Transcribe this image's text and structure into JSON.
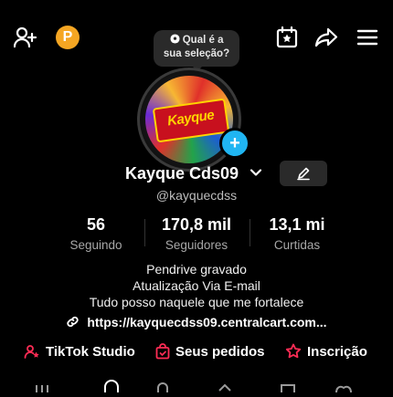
{
  "header": {
    "icons": [
      "add-user-icon",
      "coin-icon",
      "calendar-star-icon",
      "share-icon",
      "menu-icon"
    ],
    "coin_letter": "P"
  },
  "bubble": {
    "text_line1": "Qual é a",
    "text_line2": "sua seleção?"
  },
  "avatar": {
    "logo_text": "Kayque"
  },
  "profile": {
    "name": "Kayque Cds09",
    "handle": "@kayquecdss"
  },
  "stats": [
    {
      "value": "56",
      "label": "Seguindo"
    },
    {
      "value": "170,8 mil",
      "label": "Seguidores"
    },
    {
      "value": "13,1 mi",
      "label": "Curtidas"
    }
  ],
  "bio": {
    "line1": "Pendrive gravado",
    "line2": "Atualização Via E-mail",
    "line3": "Tudo posso naquele que me fortalece",
    "link": "https://kayquecdss09.centralcart.com..."
  },
  "actions": {
    "studio": "TikTok Studio",
    "orders": "Seus pedidos",
    "subscription": "Inscrição"
  },
  "colors": {
    "accent_red": "#fe2c55",
    "badge_blue": "#20b5f2",
    "coin_orange": "#f5a623"
  }
}
